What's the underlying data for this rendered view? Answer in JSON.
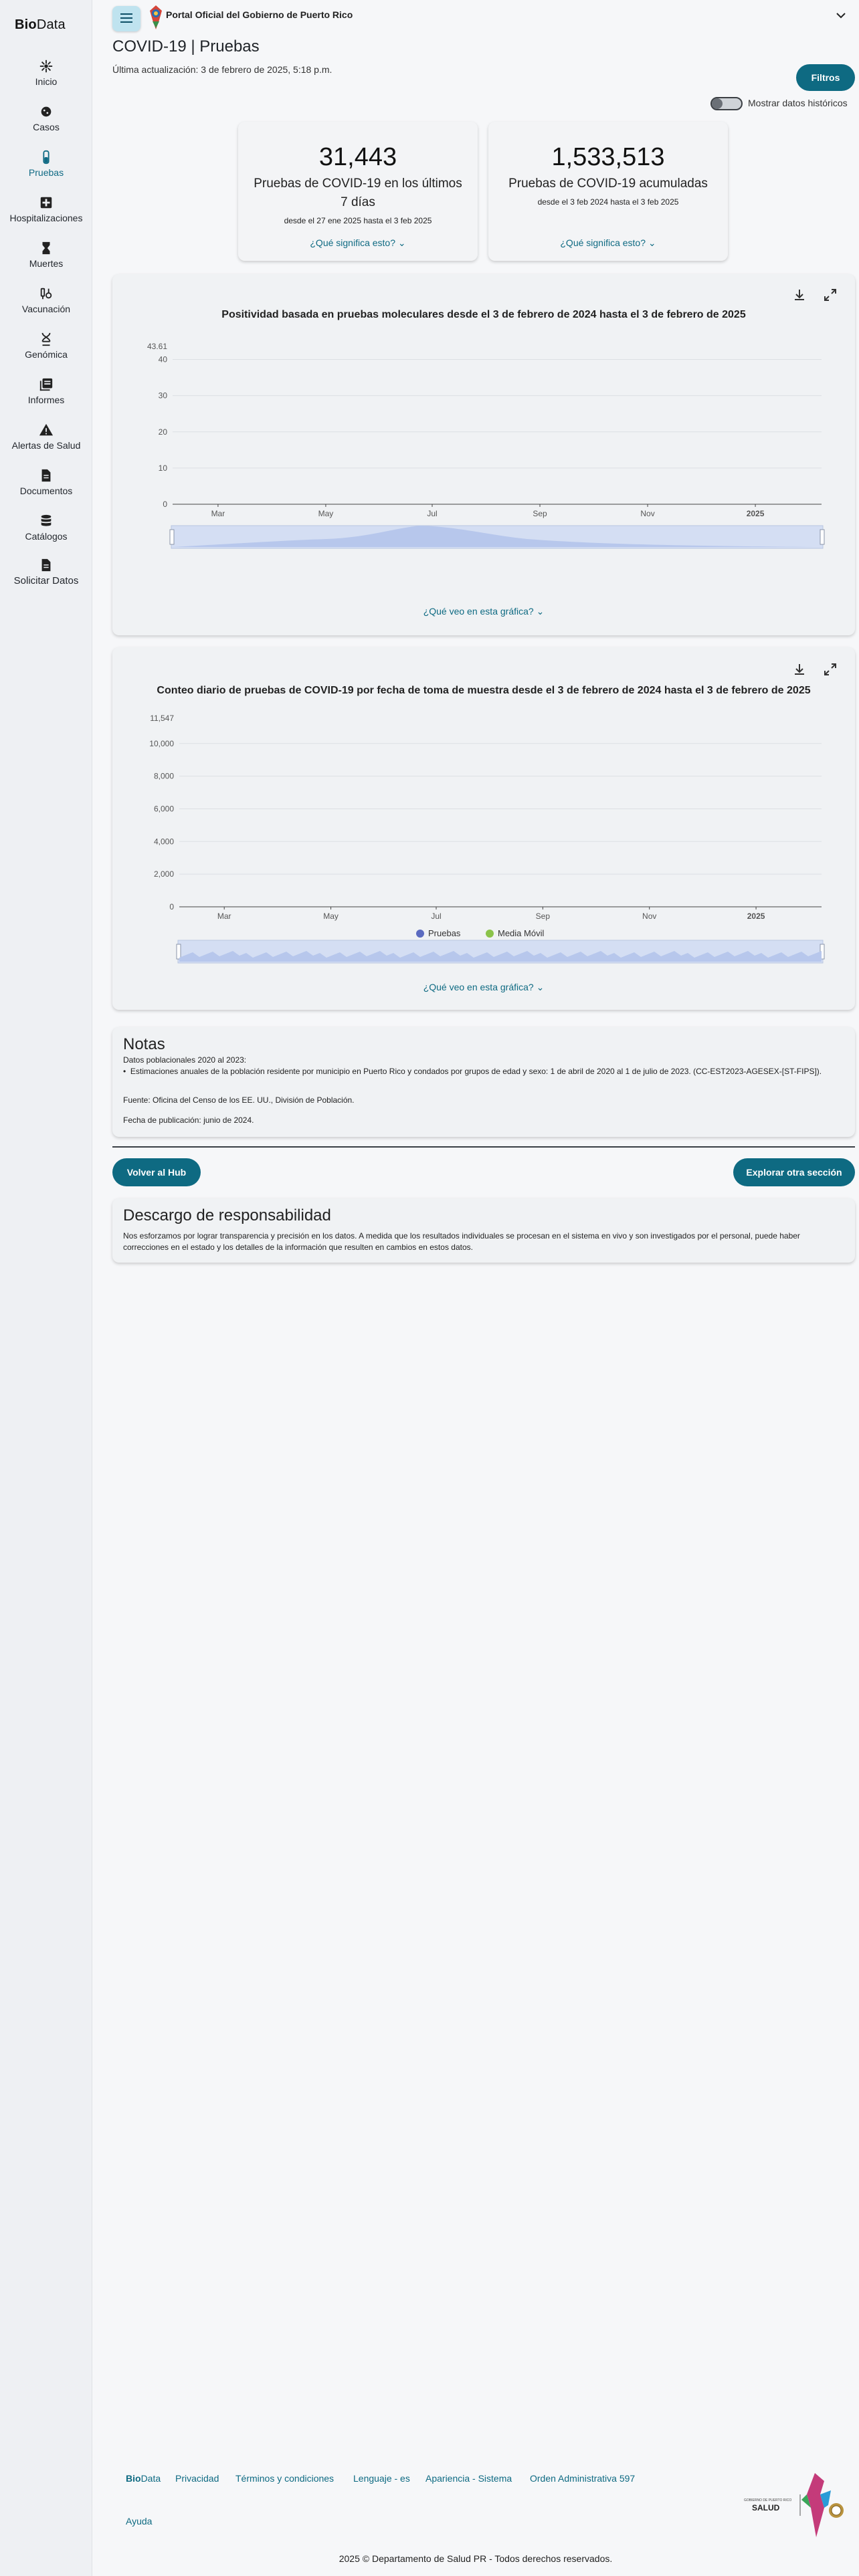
{
  "brand": {
    "bold": "Bio",
    "light": "Data"
  },
  "sidebar": {
    "items": [
      {
        "label": "Inicio",
        "icon": "virus-icon"
      },
      {
        "label": "Casos",
        "icon": "coronavirus-icon"
      },
      {
        "label": "Pruebas",
        "icon": "test-tube-icon"
      },
      {
        "label": "Hospitalizaciones",
        "icon": "hospital-icon"
      },
      {
        "label": "Muertes",
        "icon": "hourglass-icon"
      },
      {
        "label": "Vacunación",
        "icon": "vaccine-icon"
      },
      {
        "label": "Genómica",
        "icon": "dna-icon"
      },
      {
        "label": "Informes",
        "icon": "library-icon"
      },
      {
        "label": "Alertas de Salud",
        "icon": "warning-icon"
      },
      {
        "label": "Documentos",
        "icon": "document-icon"
      },
      {
        "label": "Catálogos",
        "icon": "database-icon"
      },
      {
        "label": "Solicitar Datos",
        "icon": "request-document-icon"
      }
    ],
    "active": "Pruebas"
  },
  "header": {
    "gov_text": "Portal Oficial del Gobierno de Puerto Rico"
  },
  "page": {
    "title": "COVID-19 | Pruebas",
    "updated": "Última actualización: 3 de febrero de 2025, 5:18 p.m.",
    "filters_label": "Filtros",
    "toggle_label": "Mostrar datos históricos"
  },
  "kpis": [
    {
      "value": "31,443",
      "label": "Pruebas de COVID-19 en los últimos 7 días",
      "range": "desde el 27 ene 2025 hasta el 3 feb 2025",
      "more": "¿Qué significa esto?"
    },
    {
      "value": "1,533,513",
      "label": "Pruebas de COVID-19 acumuladas",
      "range": "desde el 3 feb 2024 hasta el 3 feb 2025",
      "more": "¿Qué significa esto?"
    }
  ],
  "chart_data": [
    {
      "type": "area",
      "title": "Positividad basada en pruebas moleculares desde el 3 de febrero de 2024 hasta el 3 de febrero de 2025",
      "x_ticks": [
        "Mar",
        "May",
        "Jul",
        "Sep",
        "Nov",
        "2025"
      ],
      "y_ticks": [
        0,
        10,
        20,
        30,
        40
      ],
      "y_max_label": "43.61",
      "ylim": [
        0,
        43.61
      ],
      "grid": true,
      "series": [],
      "more": "¿Qué veo en esta gráfica?"
    },
    {
      "type": "bar",
      "title": "Conteo diario de pruebas de COVID-19 por fecha de toma de muestra desde el 3 de febrero de 2024 hasta el 3 de febrero de 2025",
      "x_ticks": [
        "Mar",
        "May",
        "Jul",
        "Sep",
        "Nov",
        "2025"
      ],
      "y_ticks": [
        "0",
        "2,000",
        "4,000",
        "6,000",
        "8,000",
        "10,000"
      ],
      "y_max_label": "11,547",
      "ylim": [
        0,
        11547
      ],
      "grid": true,
      "legend": [
        {
          "name": "Pruebas",
          "color": "#5b6bc0"
        },
        {
          "name": "Media Móvil",
          "color": "#8bc34a"
        }
      ],
      "series": [],
      "more": "¿Qué veo en esta gráfica?"
    }
  ],
  "notes": {
    "title": "Notas",
    "line1": "Datos poblacionales 2020 al 2023:",
    "bullet": "Estimaciones anuales de la población residente por municipio en Puerto Rico y condados por grupos de edad y sexo: 1 de abril de 2020 al 1 de julio de 2023. (CC-EST2023-AGESEX-[ST-FIPS]).",
    "source": "Fuente: Oficina del Censo de los EE. UU., División de Población.",
    "published": "Fecha de publicación: junio de 2024."
  },
  "buttons": {
    "back": "Volver al Hub",
    "explore": "Explorar otra sección"
  },
  "disclaimer": {
    "title": "Descargo de responsabilidad",
    "text": "Nos esforzamos por lograr transparencia y precisión en los datos. A medida que los resultados individuales se procesan en el sistema en vivo y son investigados por el personal, puede haber correcciones en el estado y los detalles de la información que resulten en cambios en estos datos."
  },
  "footer": {
    "brand_bold": "Bio",
    "brand_light": "Data",
    "links": [
      "Privacidad",
      "Términos y condiciones",
      "Lenguaje - es",
      "Apariencia - Sistema",
      "Orden Administrativa 597"
    ],
    "help": "Ayuda",
    "copyright": "2025 © Departamento de Salud PR - Todos derechos reservados.",
    "logo_text": "SALUD",
    "logo_small": "GOBIERNO DE PUERTO RICO"
  },
  "colors": {
    "accent": "#0e6a82",
    "accent_light": "#bfe3ef",
    "chart_fill": "#c9d7f3"
  }
}
